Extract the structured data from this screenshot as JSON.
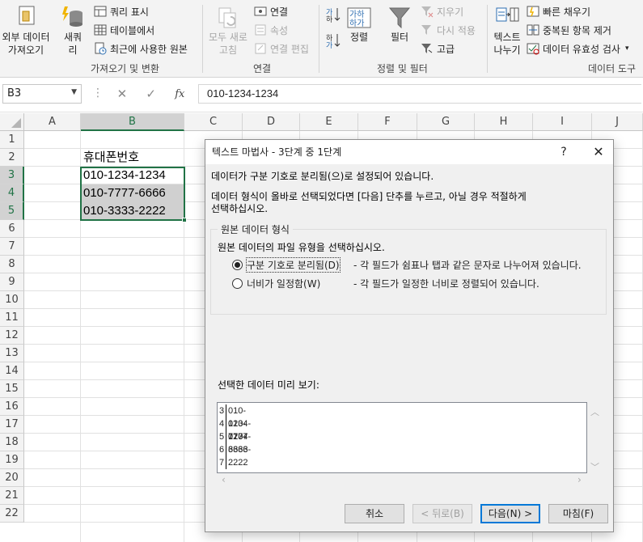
{
  "ribbon": {
    "get_external": {
      "line1": "외부 데이터",
      "line2": "가져오기"
    },
    "new_query": {
      "line1": "새쿼",
      "line2": "리"
    },
    "show_queries": "쿼리 표시",
    "from_table": "테이블에서",
    "recent_sources": "최근에 사용한 원본",
    "group_get_transform": "가져오기 및 변환",
    "refresh_all": {
      "line1": "모두 새로",
      "line2": "고침"
    },
    "connections": "연결",
    "properties": "속성",
    "edit_links": "연결 편집",
    "group_connections": "연결",
    "sort_label": "정렬",
    "filter_label": "필터",
    "clear": "지우기",
    "reapply": "다시 적용",
    "advanced": "고급",
    "group_sort_filter": "정렬 및 필터",
    "text_to_columns": {
      "line1": "텍스트",
      "line2": "나누기"
    },
    "flash_fill": "빠른 채우기",
    "remove_duplicates": "중복된 항목 제거",
    "data_validation": "데이터 유효성 검사",
    "group_data_tools": "데이터 도구",
    "sort_az_icon": "sort-az-icon",
    "sort_za_icon": "sort-za-icon"
  },
  "formula_bar": {
    "name_box": "B3",
    "fx": "fx",
    "value": "010-1234-1234"
  },
  "grid": {
    "columns": [
      "A",
      "B",
      "C",
      "D",
      "E",
      "F",
      "G",
      "H",
      "I",
      "J"
    ],
    "rows": [
      "1",
      "2",
      "3",
      "4",
      "5",
      "6",
      "7",
      "8",
      "9",
      "10",
      "11",
      "12",
      "13",
      "14",
      "15",
      "16",
      "17",
      "18",
      "19",
      "20",
      "21",
      "22"
    ],
    "cells": {
      "B2": "휴대폰번호",
      "B3": "010-1234-1234",
      "B4": "010-7777-6666",
      "B5": "010-3333-2222"
    }
  },
  "dialog": {
    "title": "텍스트 마법사 - 3단계 중 1단계",
    "help": "?",
    "close": "✕",
    "line1": "데이터가 구분 기호로 분리됨(으)로 설정되어 있습니다.",
    "line2": "데이터 형식이 올바로 선택되었다면 [다음] 단추를 누르고, 아닐 경우 적절하게",
    "line3": "선택하십시오.",
    "group_title": "원본 데이터 형식",
    "group_prompt": "원본 데이터의 파일 유형을 선택하십시오.",
    "opt_delimited": "구분 기호로 분리됨(D)",
    "opt_delimited_desc": "- 각 필드가 쉼표나 탭과 같은 문자로 나누어져 있습니다.",
    "opt_fixed": "너비가 일정함(W)",
    "opt_fixed_desc": "- 각 필드가 일정한 너비로 정렬되어 있습니다.",
    "preview_label": "선택한 데이터 미리 보기:",
    "preview_rows": [
      {
        "num": "3",
        "val": "010-1234-1234"
      },
      {
        "num": "4",
        "val": "010-7777-6666"
      },
      {
        "num": "5",
        "val": "010-3333-2222"
      },
      {
        "num": "6",
        "val": ""
      },
      {
        "num": "7",
        "val": ""
      }
    ],
    "btn_cancel": "취소",
    "btn_back": "< 뒤로(B)",
    "btn_next": "다음(N) >",
    "btn_finish": "마침(F)"
  }
}
